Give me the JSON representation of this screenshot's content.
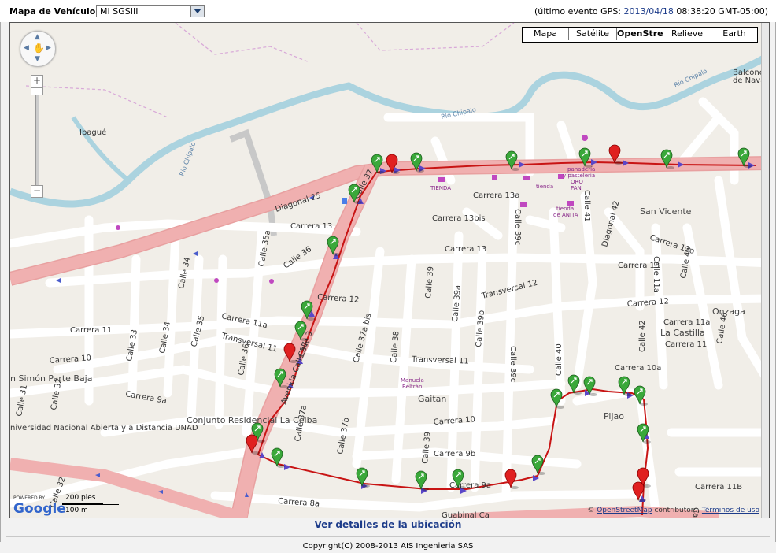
{
  "header": {
    "vehicle_label": "Mapa de Vehículo:",
    "vehicle_selected": "MI SGSIII",
    "gps_prefix": "(último evento GPS: ",
    "gps_date": "2013/04/18",
    "gps_time": " 08:38:20 GMT-05:00)"
  },
  "map_types": [
    "Mapa",
    "Satélite",
    "OpenStree",
    "Relieve",
    "Earth"
  ],
  "map_type_selected": "OpenStree",
  "controls": {
    "zoom_in": "+",
    "zoom_out": "−"
  },
  "branding": {
    "powered": "POWERED BY",
    "google": "Google"
  },
  "scale": {
    "imperial": "200 pies",
    "metric": "100 m"
  },
  "attribution": {
    "copy": "© ",
    "osm": "OpenStreetMap",
    "contrib": " contributors, ",
    "terms": "Términos de uso"
  },
  "details_link": "Ver detalles de la ubicación",
  "copyright": "Copyright(C) 2008-2013 AIS Ingenieria SAS",
  "map_labels": {
    "ibague": "Ibagué",
    "rio_chipalo1": "Río Chipalo",
    "rio_chipalo2": "Río Chipalo",
    "rio_chipalo3": "Río Chipalo",
    "balcones": "Balcones",
    "de_navar": "de Navar",
    "diagonal25": "Diagonal 25",
    "calle37a": "Calle 37",
    "carrera13a": "Carrera 13",
    "calle35a": "Calle 35a",
    "calle36": "Calle 36",
    "calle34": "Calle 34",
    "carrera13b": "Carrera 13",
    "carrera13bis": "Carrera 13bis",
    "carrera13a2": "Carrera 13a",
    "calle39c": "Calle 39c",
    "calle41": "Calle 41",
    "diagonal42": "Diagonal 42",
    "sanvicente": "San Vicente",
    "carrera13a3": "Carrera 13a",
    "carrera13c": "Carrera 13",
    "calle11a": "Calle 11a",
    "calle45": "Calle 45",
    "carrera12a": "Carrera 12",
    "carrera12b": "Carrera 12",
    "transversal12": "Transversal 12",
    "calle39": "Calle 39",
    "calle39a": "Calle 39a",
    "calle39b": "Calle 39b",
    "carrera11a": "Carrera 11a",
    "carrera11": "Carrera 11",
    "calle35": "Calle 35",
    "transversal11a": "Transversal 11",
    "calle37abis": "Calle 37a bis",
    "calle38": "Calle 38",
    "transversal11b": "Transversal 11",
    "calle39c2": "Calle 39c",
    "calle40": "Calle 40",
    "calle42": "Calle 42",
    "onzaga": "Onzaga",
    "carrera11a2": "Carrera 11a",
    "lacastilla": "La Castilla",
    "carrera11b": "Carrera 11",
    "calle46": "Calle 46",
    "carrera10": "Carrera 10",
    "calle33": "Calle 33",
    "calle34b": "Calle 34",
    "calle36b": "Calle 36",
    "avenidacalle37": "Avenida Calle 37",
    "calle3": "Calle 3",
    "carrera10a": "Carrera 10a",
    "simon": "n Simón Parte Baja",
    "calle31": "Calle 31",
    "calle32": "Calle 32",
    "carrera9a": "Carrera 9a",
    "manuela1": "Manuela",
    "manuela2": "Beltrán",
    "gaitan": "Gaitan",
    "pijao": "Pijao",
    "conjunto": "Conjunto Residencial La Ceiba",
    "unad": "niversidad Nacional Abierta y a Distancia UNAD",
    "calle37a2": "Calle 37a",
    "calle37b": "Calle 37b",
    "carrera10b": "Carrera 10",
    "calle39d": "Calle 39",
    "carrera9b": "Carrera 9b",
    "carrera9a2": "Carrera 9a",
    "carrera8a": "Carrera 8a",
    "calle32b": "Calle 32",
    "carrera11b2": "Carrera 11B",
    "guabinal": "Guabinal Ca",
    "tienda1": "TIENDA",
    "tienda2": "tienda",
    "panaderia1": "panadería",
    "panaderia2": "y pastelería",
    "panaderia3": "ORO",
    "panaderia4": "PAN",
    "tiendaanita1": "tienda",
    "tiendaanita2": "de ANITA",
    "calle3b": "Calle"
  }
}
